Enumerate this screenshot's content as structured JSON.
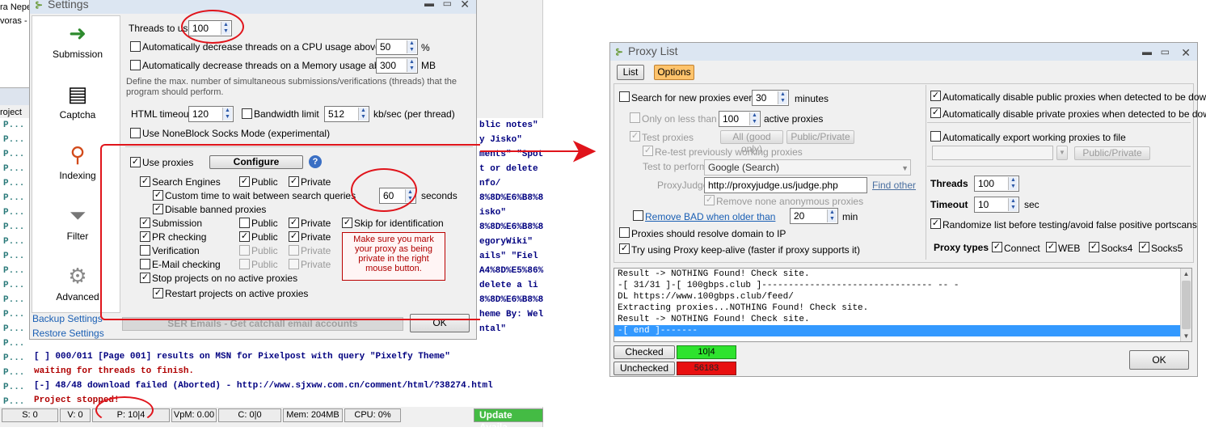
{
  "background_app": {
    "top_strip": [
      "ra Nepe",
      "voras -"
    ],
    "project_col": "roject",
    "row_prefix": "P...",
    "log_lines_right": [
      "blic notes\"",
      "y Jisko\"",
      "ments\" \"Spot",
      "t or delete",
      "nfo/",
      "8%8D%E6%B8%8",
      "isko\"",
      "8%8D%E6%B8%8",
      "egoryWiki\"",
      "ails\" \"Fiel",
      "A4%8D%E5%86%",
      "delete a li",
      "8%8D%E6%B8%8",
      "heme By: Wel",
      "ntal\""
    ],
    "log_lines_bottom": [
      {
        "text": "[ ] 000/011 [Page 001] results on MSN for Pixelpost with query \"Pixelfy Theme\"",
        "color": "#000080"
      },
      {
        "text": "waiting for threads to finish.",
        "color": "#b00000"
      },
      {
        "text": "[-] 48/48 download failed (Aborted) - http://www.sjxww.com.cn/comment/html/?38274.html",
        "color": "#000080"
      },
      {
        "text": "Project stopped!",
        "color": "#b00000"
      }
    ],
    "status_bar": {
      "s": "S: 0",
      "v": "V: 0",
      "p": "P: 10|4",
      "vpm": "VpM: 0.00",
      "c": "C: 0|0",
      "mem": "Mem: 204MB",
      "cpu": "CPU: 0%",
      "update": "Update Availa"
    }
  },
  "settings": {
    "title": "Settings",
    "sidebar": [
      "Submission",
      "Captcha",
      "Indexing",
      "Filter",
      "Advanced"
    ],
    "backup": "Backup Settings",
    "restore": "Restore Settings",
    "threads_label": "Threads to use",
    "threads_value": "100",
    "auto_cpu": "Automatically decrease threads on a CPU usage above",
    "cpu_value": "50",
    "cpu_unit": "%",
    "auto_mem": "Automatically decrease threads on a Memory usage above",
    "mem_value": "300",
    "mem_unit": "MB",
    "define_text_1": "Define the max. number of simultaneous submissions/verifications (threads) that the",
    "define_text_2": "program should perform.",
    "html_timeout": "HTML timeout",
    "html_timeout_value": "120",
    "bandwidth": "Bandwidth limit",
    "bandwidth_value": "512",
    "bandwidth_unit": "kb/sec (per thread)",
    "noneblock": "Use NoneBlock Socks Mode (experimental)",
    "use_proxies": "Use proxies",
    "configure": "Configure",
    "help": "?",
    "search_engines": "Search Engines",
    "public": "Public",
    "private": "Private",
    "custom_time": "Custom time to wait between search queries",
    "custom_time_value": "60",
    "seconds": "seconds",
    "disable_banned": "Disable banned proxies",
    "submission": "Submission",
    "skip_ident": "Skip for identification",
    "pr_checking": "PR checking",
    "verification": "Verification",
    "email_checking": "E-Mail checking",
    "warning": "Make sure you mark your proxy as being private in the right mouse button.",
    "stop_projects": "Stop projects on no active proxies",
    "restart_projects": "Restart projects on active proxies",
    "ser_emails": "SER Emails - Get catchall email accounts",
    "ok": "OK"
  },
  "proxy": {
    "title": "Proxy List",
    "tab_list": "List",
    "tab_options": "Options",
    "search_new": "Search for new proxies every",
    "search_value": "30",
    "minutes": "minutes",
    "only_less": "Only on less than",
    "only_value": "100",
    "active_proxies": "active proxies",
    "test_proxies": "Test proxies",
    "all_good": "All (good only)",
    "public_private": "Public/Private",
    "retest": "Re-test previously working proxies",
    "test_to_perform": "Test to perform",
    "test_value": "Google (Search)",
    "proxyjudge": "ProxyJudge",
    "proxyjudge_value": "http://proxyjudge.us/judge.php",
    "find_other": "Find other",
    "remove_anon": "Remove none anonymous proxies",
    "remove_bad": "Remove BAD when older than",
    "remove_value": "20",
    "min": "min",
    "resolve": "Proxies should resolve domain to IP",
    "keepalive": "Try using Proxy keep-alive (faster if proxy supports it)",
    "auto_public": "Automatically disable public proxies when detected to be down",
    "auto_private": "Automatically disable private proxies when detected to be down",
    "auto_export": "Automatically export working proxies to file",
    "export_public_private": "Public/Private",
    "threads": "Threads",
    "threads_value": "100",
    "timeout": "Timeout",
    "timeout_value": "10",
    "sec": "sec",
    "randomize": "Randomize list before testing/avoid false positive portscans",
    "proxy_types": "Proxy types",
    "types": [
      "Connect",
      "WEB",
      "Socks4",
      "Socks5"
    ],
    "log": [
      "Result -> NOTHING Found! Check site.",
      "-[ 31/31 ]-[ 100gbps.club ]-------------------------------- -- -",
      "DL https://www.100gbps.club/feed/",
      "Extracting proxies...NOTHING Found! Check site.",
      "Result -> NOTHING Found! Check site.",
      "-[ end ]-------"
    ],
    "checked": "Checked",
    "checked_value": "10|4",
    "unchecked": "Unchecked",
    "unchecked_value": "56183",
    "ok": "OK"
  },
  "colors": {
    "options_tab": "#ffc36b",
    "checked_value": "#2ee32e",
    "unchecked_value": "#e81010",
    "annotation": "#e0141b",
    "selection": "#3399ff",
    "update_bar": "#44bb44"
  }
}
